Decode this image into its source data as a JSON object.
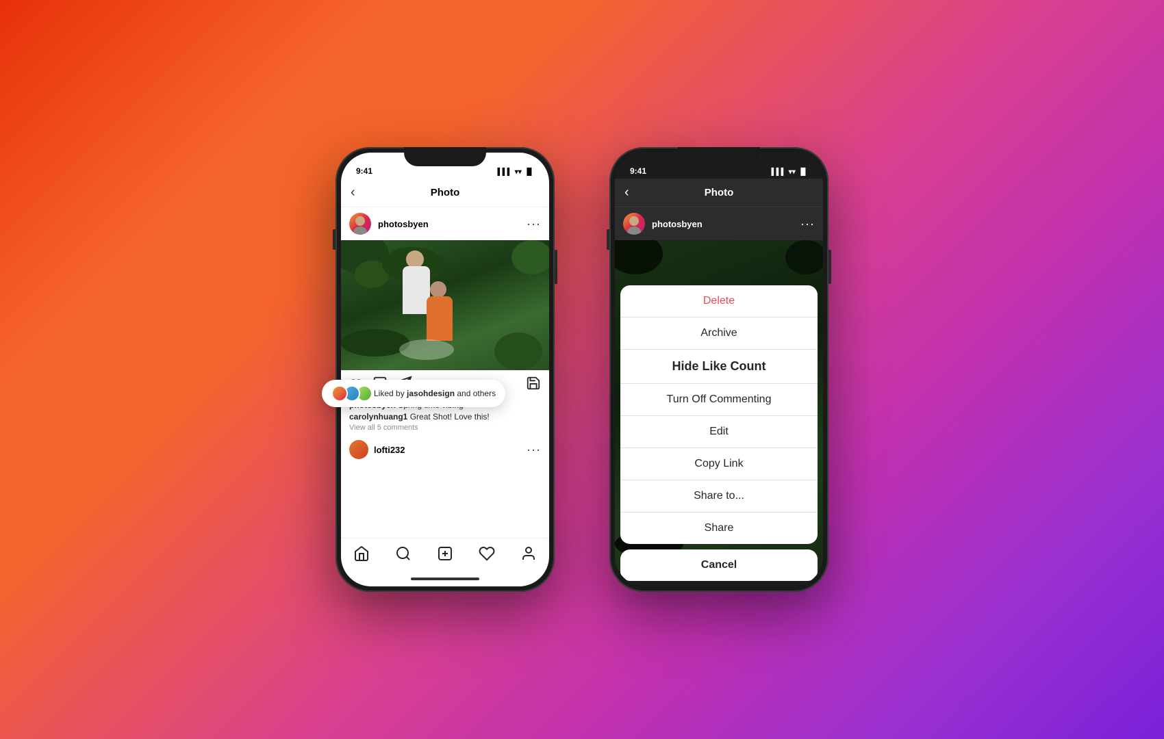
{
  "background": {
    "gradient": "linear-gradient(135deg, #e8300a, #f5642a, #d94090, #c030b0, #7b20d8)"
  },
  "phone_left": {
    "status_bar": {
      "time": "9:41",
      "signal": "▌▌▌",
      "wifi": "WiFi",
      "battery": "🔋"
    },
    "nav": {
      "back": "‹",
      "title": "Photo"
    },
    "user": {
      "username": "photosbyen",
      "more": "···"
    },
    "liked_by": {
      "text_prefix": "Liked by ",
      "highlighted_user": "jasohdesign",
      "text_suffix": " and others"
    },
    "caption": {
      "user": "photosbyen",
      "text": "Spring time vibing"
    },
    "comment": {
      "user": "carolynhuang1",
      "text": "Great Shot! Love this!"
    },
    "view_comments": "View all 5 comments",
    "comment_user": "lofti232",
    "bottom_nav": {
      "home": "⌂",
      "search": "🔍",
      "plus": "⊕",
      "heart": "♡",
      "profile": "👤"
    }
  },
  "phone_right": {
    "status_bar": {
      "time": "9:41",
      "signal": "▌▌▌",
      "wifi": "WiFi",
      "battery": "🔋"
    },
    "nav": {
      "back": "‹",
      "title": "Photo"
    },
    "user": {
      "username": "photosbyen",
      "more": "···"
    },
    "action_sheet": {
      "items": [
        {
          "label": "Delete",
          "style": "delete"
        },
        {
          "label": "Archive",
          "style": "normal"
        },
        {
          "label": "Hide Like Count",
          "style": "bold"
        },
        {
          "label": "Turn Off Commenting",
          "style": "normal"
        },
        {
          "label": "Edit",
          "style": "normal"
        },
        {
          "label": "Copy Link",
          "style": "normal"
        },
        {
          "label": "Share to...",
          "style": "normal"
        },
        {
          "label": "Share",
          "style": "normal"
        }
      ],
      "cancel": "Cancel"
    }
  }
}
